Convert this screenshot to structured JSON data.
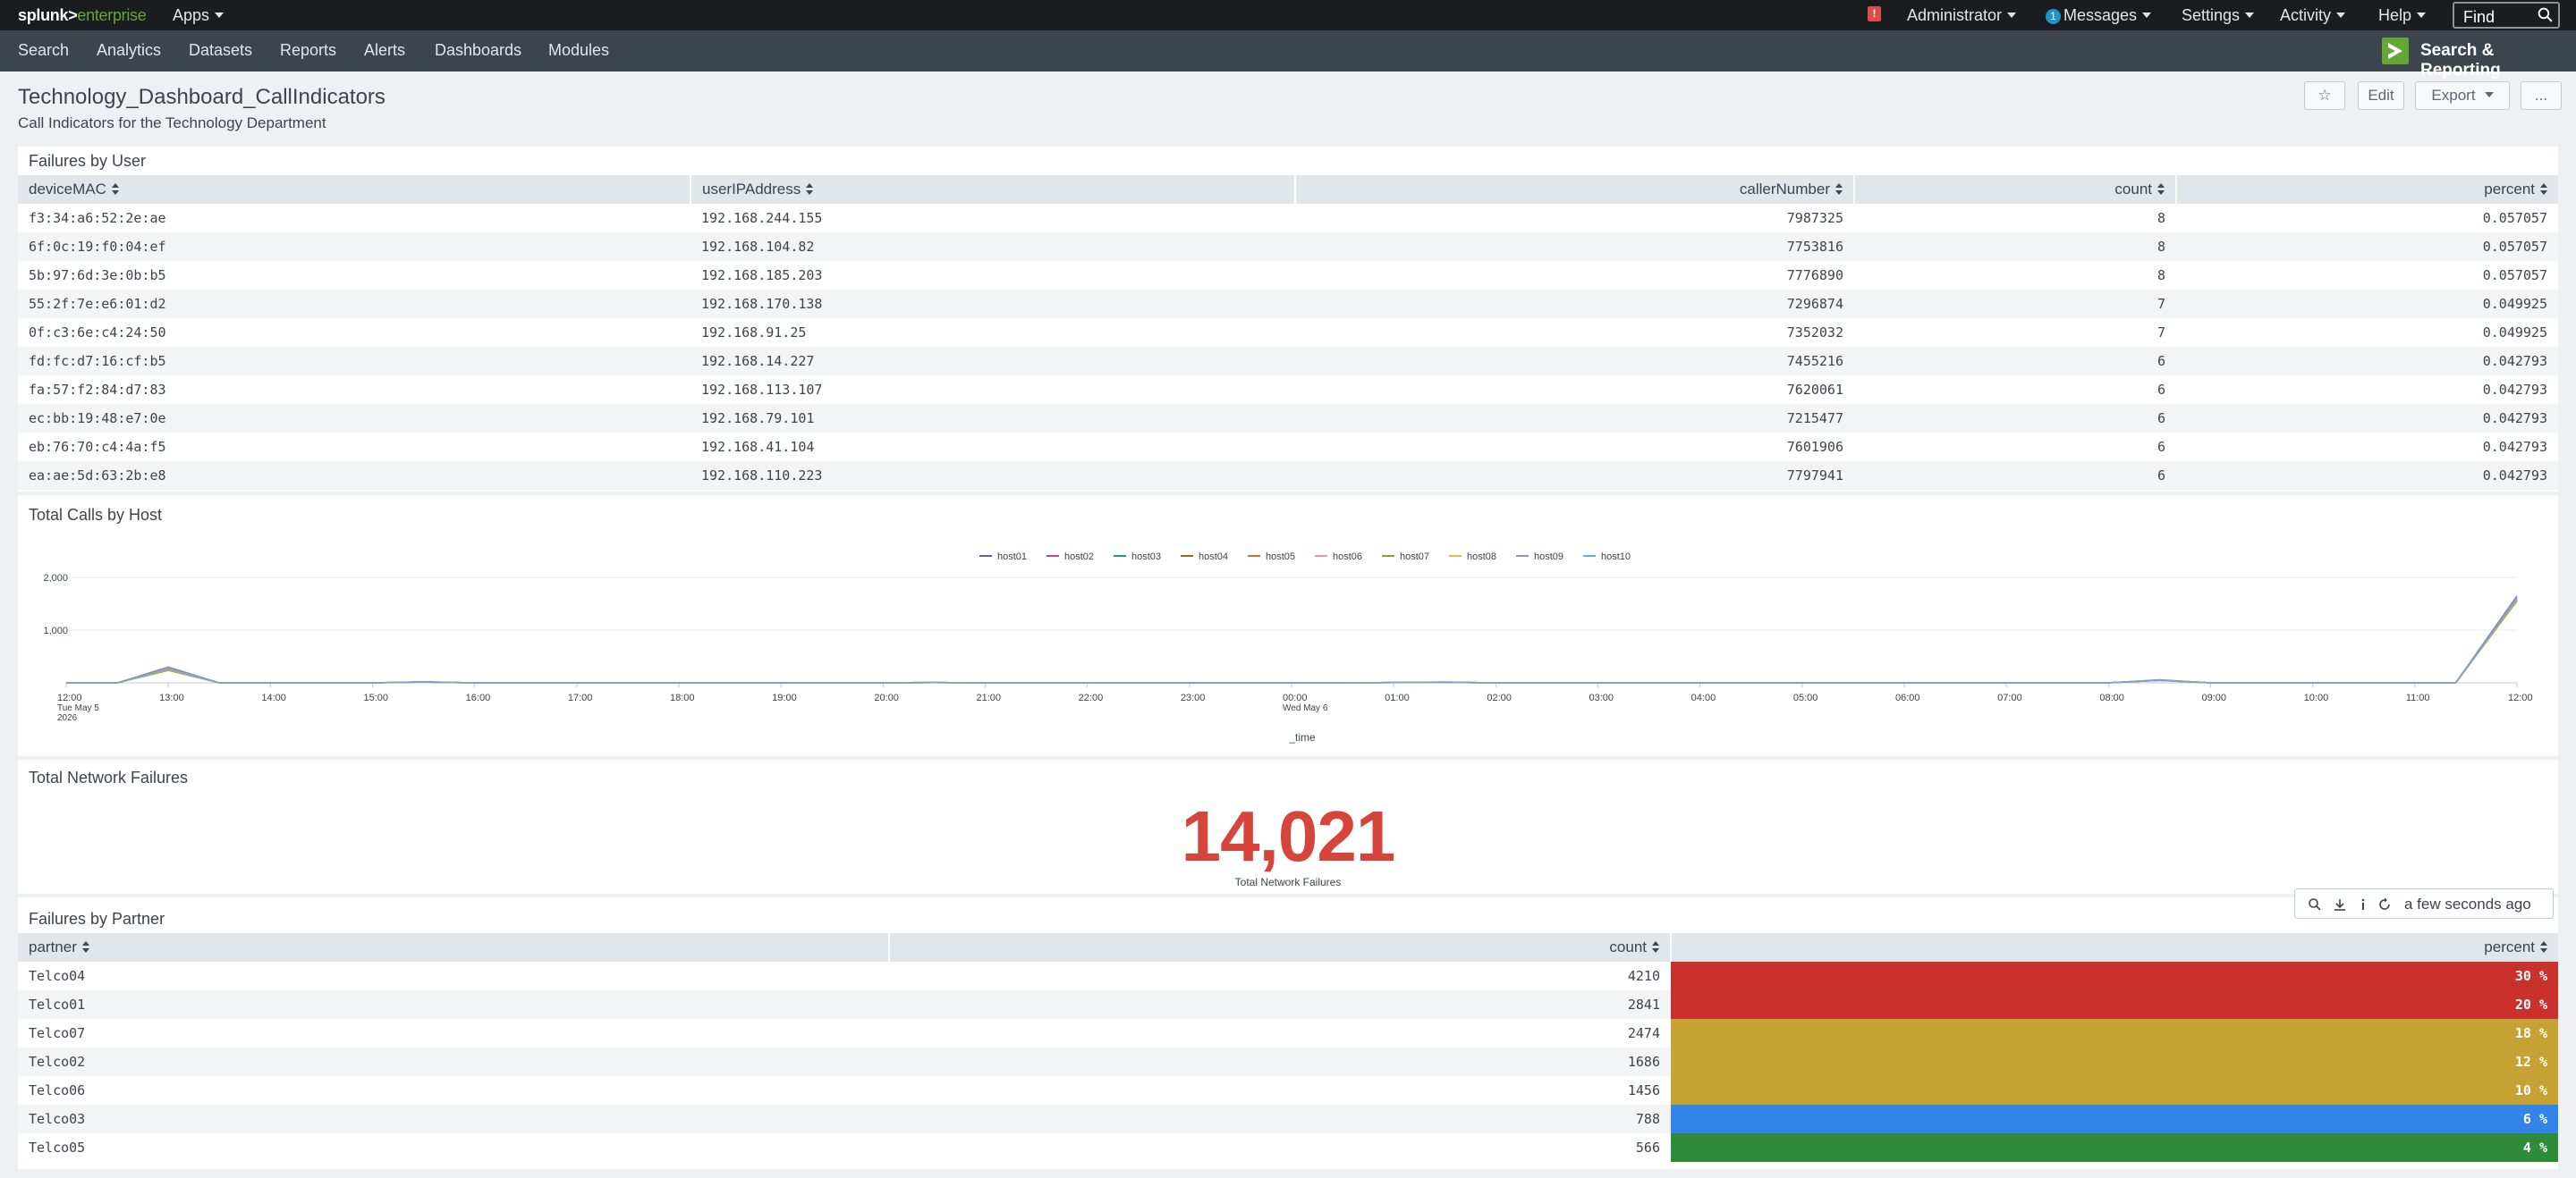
{
  "topbar": {
    "logo_main": "splunk>",
    "logo_sub": "enterprise",
    "apps_label": "Apps",
    "admin_label": "Administrator",
    "messages_count": "1",
    "messages_label": "Messages",
    "settings_label": "Settings",
    "activity_label": "Activity",
    "help_label": "Help",
    "find_placeholder": "Find"
  },
  "appbar": {
    "nav": [
      "Search",
      "Analytics",
      "Datasets",
      "Reports",
      "Alerts",
      "Dashboards",
      "Modules"
    ],
    "app_name": "Search & Reporting"
  },
  "dashboard": {
    "title": "Technology_Dashboard_CallIndicators",
    "description": "Call Indicators for the Technology Department",
    "star_label": "☆",
    "edit_label": "Edit",
    "export_label": "Export",
    "more_label": "..."
  },
  "failures_by_user": {
    "title": "Failures by User",
    "columns": [
      "deviceMAC",
      "userIPAddress",
      "callerNumber",
      "count",
      "percent"
    ],
    "rows": [
      [
        "f3:34:a6:52:2e:ae",
        "192.168.244.155",
        "7987325",
        "8",
        "0.057057"
      ],
      [
        "6f:0c:19:f0:04:ef",
        "192.168.104.82",
        "7753816",
        "8",
        "0.057057"
      ],
      [
        "5b:97:6d:3e:0b:b5",
        "192.168.185.203",
        "7776890",
        "8",
        "0.057057"
      ],
      [
        "55:2f:7e:e6:01:d2",
        "192.168.170.138",
        "7296874",
        "7",
        "0.049925"
      ],
      [
        "0f:c3:6e:c4:24:50",
        "192.168.91.25",
        "7352032",
        "7",
        "0.049925"
      ],
      [
        "fd:fc:d7:16:cf:b5",
        "192.168.14.227",
        "7455216",
        "6",
        "0.042793"
      ],
      [
        "fa:57:f2:84:d7:83",
        "192.168.113.107",
        "7620061",
        "6",
        "0.042793"
      ],
      [
        "ec:bb:19:48:e7:0e",
        "192.168.79.101",
        "7215477",
        "6",
        "0.042793"
      ],
      [
        "eb:76:70:c4:4a:f5",
        "192.168.41.104",
        "7601906",
        "6",
        "0.042793"
      ],
      [
        "ea:ae:5d:63:2b:e8",
        "192.168.110.223",
        "7797941",
        "6",
        "0.042793"
      ]
    ]
  },
  "calls_by_host": {
    "title": "Total Calls by Host"
  },
  "chart_data": {
    "type": "line",
    "title": "Total Calls by Host",
    "xlabel": "_time",
    "ylabel": "",
    "ylim": [
      0,
      2000
    ],
    "y_ticks": [
      "2,000",
      "1,000"
    ],
    "legend_position": "top",
    "x_ticks": [
      "12:00",
      "13:00",
      "14:00",
      "15:00",
      "16:00",
      "17:00",
      "18:00",
      "19:00",
      "20:00",
      "21:00",
      "22:00",
      "23:00",
      "00:00",
      "01:00",
      "02:00",
      "03:00",
      "04:00",
      "05:00",
      "06:00",
      "07:00",
      "08:00",
      "09:00",
      "10:00",
      "11:00",
      "12:00"
    ],
    "x_subticks": {
      "0": [
        "Tue May 5",
        "2026"
      ],
      "12": [
        "Wed May 6"
      ]
    },
    "x_hours": [
      0,
      0.5,
      1,
      1.5,
      2,
      3,
      3.5,
      4,
      4.5,
      5,
      6,
      7,
      8,
      8.5,
      9,
      10,
      11,
      12,
      12.5,
      13,
      13.5,
      14,
      15,
      16,
      17,
      18,
      19,
      20,
      20.5,
      21,
      22,
      23,
      23.4,
      24
    ],
    "series": [
      {
        "name": "host01",
        "color": "#6a5c9e",
        "values": [
          0,
          0,
          300,
          0,
          0,
          0,
          20,
          0,
          0,
          0,
          0,
          0,
          0,
          5,
          0,
          0,
          0,
          0,
          0,
          5,
          15,
          0,
          0,
          0,
          0,
          0,
          0,
          0,
          60,
          0,
          0,
          0,
          0,
          1650
        ]
      },
      {
        "name": "host02",
        "color": "#d63d8b",
        "values": [
          0,
          0,
          260,
          0,
          0,
          0,
          15,
          0,
          0,
          0,
          0,
          0,
          0,
          5,
          0,
          0,
          0,
          0,
          0,
          5,
          10,
          0,
          0,
          0,
          0,
          0,
          0,
          0,
          50,
          0,
          0,
          0,
          0,
          1600
        ]
      },
      {
        "name": "host03",
        "color": "#1e9e7a",
        "values": [
          0,
          0,
          240,
          0,
          0,
          0,
          15,
          0,
          0,
          0,
          0,
          0,
          0,
          5,
          0,
          0,
          0,
          0,
          0,
          5,
          10,
          0,
          0,
          0,
          0,
          0,
          0,
          0,
          45,
          0,
          0,
          0,
          0,
          1560
        ]
      },
      {
        "name": "host04",
        "color": "#9b6b14",
        "values": [
          0,
          0,
          250,
          0,
          0,
          0,
          15,
          0,
          0,
          0,
          0,
          0,
          0,
          5,
          0,
          0,
          0,
          0,
          0,
          5,
          10,
          0,
          0,
          0,
          0,
          0,
          0,
          0,
          50,
          0,
          0,
          0,
          0,
          1580
        ]
      },
      {
        "name": "host05",
        "color": "#d46a2c",
        "values": [
          0,
          0,
          245,
          0,
          0,
          0,
          15,
          0,
          0,
          0,
          0,
          0,
          0,
          5,
          0,
          0,
          0,
          0,
          0,
          5,
          10,
          0,
          0,
          0,
          0,
          0,
          0,
          0,
          48,
          0,
          0,
          0,
          0,
          1570
        ]
      },
      {
        "name": "host06",
        "color": "#e895b9",
        "values": [
          0,
          0,
          255,
          0,
          0,
          0,
          15,
          0,
          0,
          0,
          0,
          0,
          0,
          5,
          0,
          0,
          0,
          0,
          0,
          5,
          10,
          0,
          0,
          0,
          0,
          0,
          0,
          0,
          50,
          0,
          0,
          0,
          0,
          1590
        ]
      },
      {
        "name": "host07",
        "color": "#8aa32b",
        "values": [
          0,
          0,
          235,
          0,
          0,
          0,
          15,
          0,
          0,
          0,
          0,
          0,
          0,
          5,
          0,
          0,
          0,
          0,
          0,
          5,
          10,
          0,
          0,
          0,
          0,
          0,
          0,
          0,
          45,
          0,
          0,
          0,
          0,
          1550
        ]
      },
      {
        "name": "host08",
        "color": "#e6b84a",
        "values": [
          0,
          0,
          250,
          0,
          0,
          0,
          15,
          0,
          0,
          0,
          0,
          0,
          0,
          5,
          0,
          0,
          0,
          0,
          0,
          5,
          10,
          0,
          0,
          0,
          0,
          0,
          0,
          0,
          50,
          0,
          0,
          0,
          0,
          1575
        ]
      },
      {
        "name": "host09",
        "color": "#8e8ec7",
        "values": [
          0,
          0,
          280,
          0,
          0,
          0,
          18,
          0,
          0,
          0,
          0,
          0,
          0,
          5,
          0,
          0,
          0,
          0,
          0,
          5,
          12,
          0,
          0,
          0,
          0,
          0,
          0,
          0,
          55,
          0,
          0,
          0,
          0,
          1620
        ]
      },
      {
        "name": "host10",
        "color": "#6fa8dc",
        "values": [
          0,
          0,
          265,
          0,
          0,
          0,
          16,
          0,
          0,
          0,
          0,
          0,
          0,
          5,
          0,
          0,
          0,
          0,
          0,
          5,
          11,
          0,
          0,
          0,
          0,
          0,
          0,
          0,
          52,
          0,
          0,
          0,
          0,
          1600
        ]
      }
    ]
  },
  "network_failures": {
    "title": "Total Network Failures",
    "value": "14,021",
    "label": "Total Network Failures",
    "color": "#d6453b"
  },
  "refresh_widget": {
    "text": "a few seconds ago"
  },
  "failures_by_partner": {
    "title": "Failures by Partner",
    "columns": [
      "partner",
      "count",
      "percent"
    ],
    "rows": [
      [
        "Telco04",
        "4210",
        "30 %",
        "#c9312c"
      ],
      [
        "Telco01",
        "2841",
        "20 %",
        "#c9312c"
      ],
      [
        "Telco07",
        "2474",
        "18 %",
        "#c6a235"
      ],
      [
        "Telco02",
        "1686",
        "12 %",
        "#c6a235"
      ],
      [
        "Telco06",
        "1456",
        "10 %",
        "#c6a235"
      ],
      [
        "Telco03",
        "788",
        "6 %",
        "#3284e6"
      ],
      [
        "Telco05",
        "566",
        "4 %",
        "#2e8b3a"
      ]
    ]
  }
}
